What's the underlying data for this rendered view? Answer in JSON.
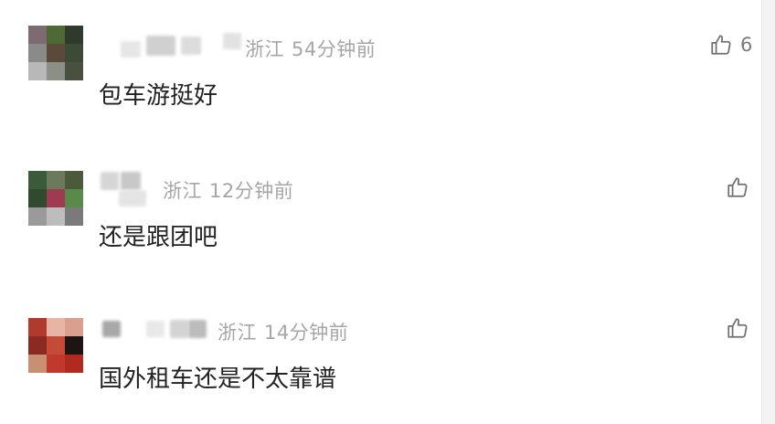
{
  "comments": [
    {
      "location": "浙江",
      "time": "54分钟前",
      "text": "包车游挺好",
      "likes": "6",
      "avatar_colors": [
        "#7d6a73",
        "#4d6a35",
        "#2f3a2c",
        "#8a8a8a",
        "#5a4a3a",
        "#3c4a36",
        "#b8b8b8",
        "#8c8f86",
        "#4a5040"
      ]
    },
    {
      "location": "浙江",
      "time": "12分钟前",
      "text": "还是跟团吧",
      "likes": "",
      "avatar_colors": [
        "#3a5a3a",
        "#6a7a5a",
        "#4a5a3a",
        "#2f4a2f",
        "#a03a50",
        "#5a8a4a",
        "#9a9a9a",
        "#bdbdbd",
        "#7a7a7a"
      ]
    },
    {
      "location": "浙江",
      "time": "14分钟前",
      "text": "国外租车还是不太靠谱",
      "likes": "",
      "avatar_colors": [
        "#b03a2e",
        "#e8b4a6",
        "#d9a090",
        "#8a2a22",
        "#c44a3a",
        "#1e1414",
        "#c89070",
        "#c0392b",
        "#b02a20"
      ]
    }
  ],
  "icons": {
    "like": "thumbs-up-icon"
  }
}
